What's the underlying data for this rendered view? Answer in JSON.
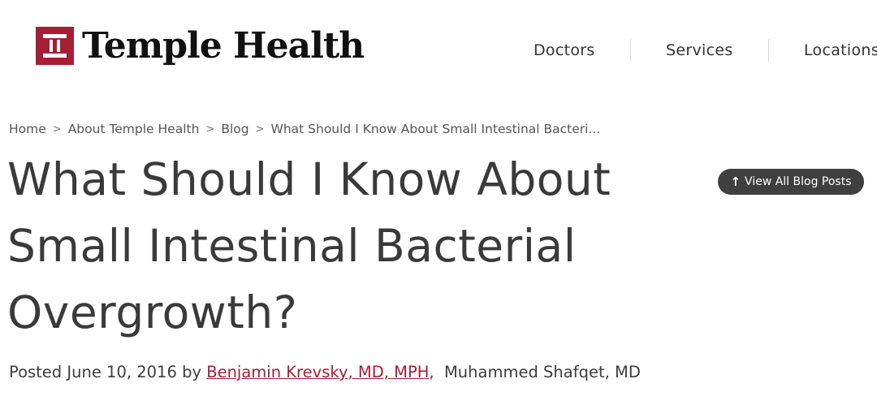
{
  "header": {
    "logo_text": "Temple Health",
    "brand_color": "#a41e35",
    "nav": [
      {
        "label": "Doctors"
      },
      {
        "label": "Services"
      },
      {
        "label": "Locations"
      }
    ]
  },
  "breadcrumb": {
    "items": [
      "Home",
      "About Temple Health",
      "Blog"
    ],
    "separator": ">",
    "current": "What Should I Know About Small Intestinal Bacteri..."
  },
  "article": {
    "title": "What Should I Know About Small Intestinal Bacterial Overgrowth?",
    "view_all_label": "View All Blog Posts",
    "view_all_icon": "arrow-up-icon",
    "byline": {
      "posted_prefix": "Posted June 10, 2016 by",
      "author_linked": "Benjamin Krevsky, MD, MPH",
      "separator": ",",
      "coauthor": "Muhammed Shafqet, MD"
    }
  }
}
